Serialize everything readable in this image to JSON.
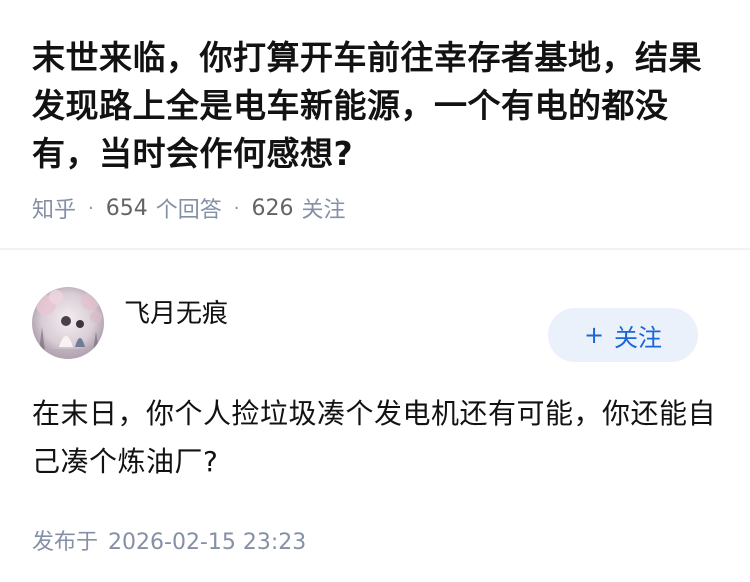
{
  "question": {
    "title": "末世来临，你打算开车前往幸存者基地，结果发现路上全是电车新能源，一个有电的都没有，当时会作何感想?",
    "source": "知乎",
    "answers_count": "654",
    "answers_label": "个回答",
    "follow_count": "626",
    "follow_label": "关注"
  },
  "answer": {
    "author_name": "飞月无痕",
    "follow_button_label": "关注",
    "follow_button_icon": "+",
    "content": "在末日，你个人捡垃圾凑个发电机还有可能，你还能自己凑个炼油厂?",
    "publish_label": "发布于",
    "publish_date": "2026-02-15 23:23"
  },
  "colors": {
    "accent": "#1a66d6",
    "follow_bg": "#eaf1fb",
    "meta": "#8590a6",
    "text": "#121212"
  }
}
